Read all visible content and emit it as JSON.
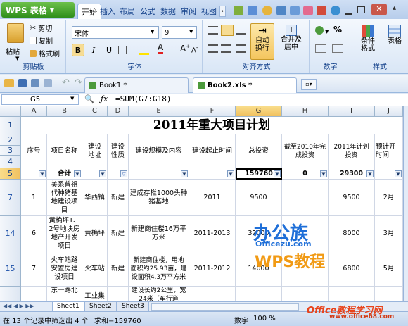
{
  "app": {
    "name": "WPS 表格"
  },
  "menu_tabs": [
    "开始",
    "插入",
    "布局",
    "公式",
    "数据",
    "审阅",
    "视图"
  ],
  "ribbon": {
    "clipboard": {
      "label": "剪贴板",
      "paste": "粘贴",
      "cut": "剪切",
      "copy": "复制",
      "format_painter": "格式刷"
    },
    "font": {
      "label": "字体",
      "name": "宋体",
      "size": "9",
      "bold": "B",
      "italic": "I",
      "underline": "U"
    },
    "alignment": {
      "label": "对齐方式",
      "wrap": "自动\n换行",
      "merge": "合并及\n居中"
    },
    "number": {
      "label": "数字",
      "percent": "%"
    },
    "style": {
      "label": "样式",
      "conditional": "条件\n格式",
      "table_style": "表格"
    }
  },
  "doc_tabs": [
    {
      "name": "Book1 *",
      "active": false
    },
    {
      "name": "Book2.xls *",
      "active": true
    }
  ],
  "formula_bar": {
    "cell_ref": "G5",
    "formula": "=SUM(G7:G18)"
  },
  "columns": [
    "A",
    "B",
    "C",
    "D",
    "E",
    "F",
    "G",
    "H",
    "I",
    "J"
  ],
  "selected_column": "G",
  "title": "2011年重大项目计划",
  "headers": [
    "序号",
    "项目名称",
    "建设\n地址",
    "建设\n性质",
    "建设规模及内容",
    "建设起止时间",
    "总投资",
    "截至2010年完\n成投资",
    "2011年计划\n投资",
    "预计开\n时间"
  ],
  "total_row": {
    "label": "合计",
    "G": "159760",
    "H": "0",
    "I": "29300"
  },
  "rows": [
    {
      "row_num": "7",
      "seq": "1",
      "name": "美系曾祖\n代种猪基\n地建设项\n目",
      "addr": "华西镇",
      "nature": "新建",
      "scale": "建成存栏1000头种\n猪基地",
      "period": "2011",
      "total": "9500",
      "done": "",
      "plan": "9500",
      "start": "2月"
    },
    {
      "row_num": "14",
      "seq": "6",
      "name": "黄桷坪1、\n2号地块房\n地产开发\n项目",
      "addr": "黄桷坪",
      "nature": "新建",
      "scale": "新建商住楼16万平\n方米",
      "period": "2011-2013",
      "total": "32000",
      "done": "",
      "plan": "8000",
      "start": "3月"
    },
    {
      "row_num": "15",
      "seq": "7",
      "name": "火车站路\n安置房建\n设项目",
      "addr": "火车站",
      "nature": "新建",
      "scale": "新建商住楼，用地\n面积约25.93亩，建\n设面积4.3万平方米",
      "period": "2011-2012",
      "total": "14000",
      "done": "",
      "plan": "6800",
      "start": "5月"
    },
    {
      "row_num": "",
      "seq": "",
      "name": "东一路北",
      "addr": "工业集",
      "nature": "",
      "scale": "建设长约2公里，宽\n24米（车行道",
      "period": "",
      "total": "",
      "done": "",
      "plan": "",
      "start": ""
    }
  ],
  "sheets": [
    "Sheet1",
    "Sheet2",
    "Sheet3"
  ],
  "status": {
    "record_info": "在 13 个记录中筛选出 4 个",
    "sum": "求和=159760",
    "numlock": "数字",
    "zoom": "100 %"
  },
  "watermark": {
    "brand": "办公族",
    "site": "Officezu.com",
    "wps": "WPS教程",
    "bottom": "Office教程学习网",
    "url": "www.office68.com"
  },
  "colors": {
    "accent": "#2f8f1b",
    "header_blue": "#15428b",
    "selection": "#f1c15f"
  }
}
